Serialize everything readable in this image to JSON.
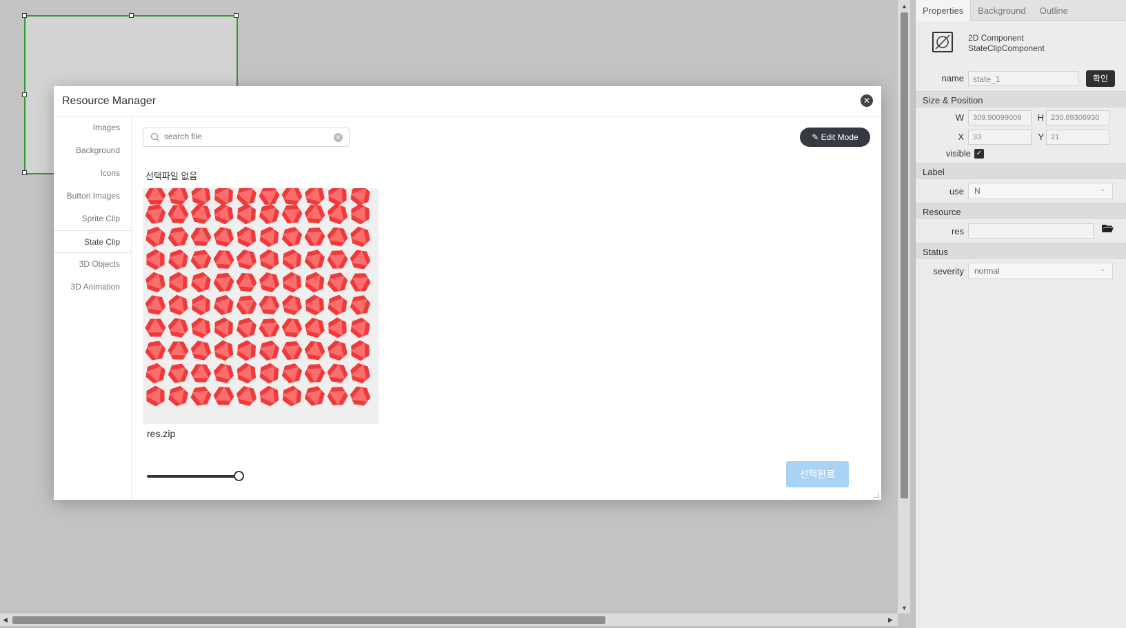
{
  "properties_panel": {
    "tabs": [
      "Properties",
      "Background",
      "Outline"
    ],
    "component_kind": "2D Component",
    "component_class": "StateClipComponent",
    "name_label": "name",
    "name_value": "state_1",
    "confirm_label": "확인",
    "size_section": "Size & Position",
    "w_label": "W",
    "w_value": "309.90099009",
    "h_label": "H",
    "h_value": "230.69306930",
    "x_label": "X",
    "x_value": "33",
    "y_label": "Y",
    "y_value": "21",
    "visible_label": "visible",
    "visible_checked": true,
    "label_section": "Label",
    "use_label": "use",
    "use_value": "N",
    "resource_section": "Resource",
    "res_label": "res",
    "res_value": "",
    "status_section": "Status",
    "severity_label": "severity",
    "severity_value": "normal"
  },
  "modal": {
    "title": "Resource Manager",
    "sidebar": [
      {
        "label": "Images",
        "active": false
      },
      {
        "label": "Background",
        "active": false
      },
      {
        "label": "Icons",
        "active": false
      },
      {
        "label": "Button Images",
        "active": false
      },
      {
        "label": "Sprite Clip",
        "active": false
      },
      {
        "label": "State Clip",
        "active": true
      },
      {
        "label": "3D Objects",
        "active": false
      },
      {
        "label": "3D Animation",
        "active": false
      }
    ],
    "search_placeholder": "search file",
    "edit_mode_label": "Edit Mode",
    "no_selection_text": "선택파일 없음",
    "file": {
      "name": "res.zip",
      "grid_rows": 10,
      "grid_cols": 10,
      "sprite_color": "#f03a3a"
    },
    "zoom_level": 1.0,
    "select_done_label": "선택완료"
  },
  "colors": {
    "selection_border": "#2e9b2e",
    "primary_button": "#343a40",
    "disabled_button": "#a9d3f5"
  }
}
